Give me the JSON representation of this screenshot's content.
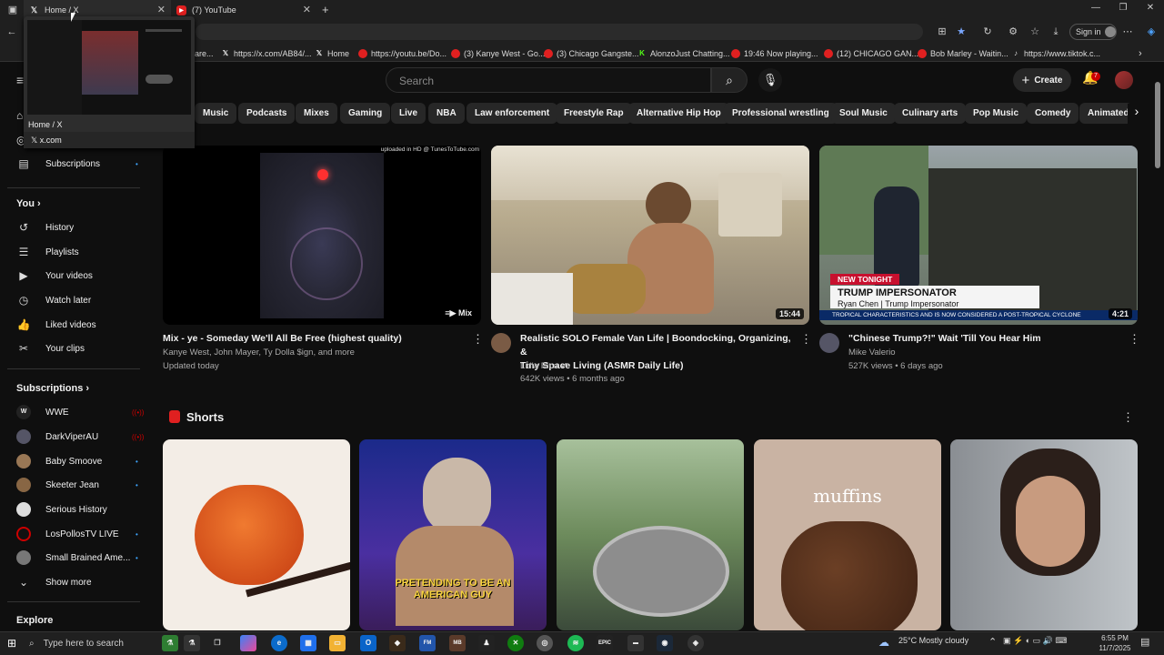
{
  "browser": {
    "tabs": [
      {
        "title": "Home / X",
        "icon": "x-logo-icon"
      },
      {
        "title": "(7) YouTube",
        "icon": "youtube-icon"
      }
    ],
    "new_tab": "+",
    "sign_in": "Sign in",
    "bookmarks": [
      "are...",
      "https://x.com/AB84/...",
      "Home",
      "https://youtu.be/Do...",
      "(3) Kanye West - Go...",
      "(3) Chicago Gangste...",
      "AlonzoJust Chatting...",
      "19:46 Now playing...",
      "(12) CHICAGO GAN...",
      "Bob Marley - Waitin...",
      "https://www.tiktok.c..."
    ],
    "hover_preview": {
      "title": "Home / X",
      "url": "x.com"
    }
  },
  "youtube": {
    "search_placeholder": "Search",
    "create_label": "Create",
    "notification_count": "7",
    "chips": [
      "Music",
      "Podcasts",
      "Mixes",
      "Gaming",
      "Live",
      "NBA",
      "Law enforcement",
      "Freestyle Rap",
      "Alternative Hip Hop",
      "Professional wrestling",
      "Soul Music",
      "Culinary arts",
      "Pop Music",
      "Comedy",
      "Animated"
    ],
    "sidebar": {
      "subscriptions_top": "Subscriptions",
      "you_header": "You",
      "you_items": [
        {
          "label": "History",
          "icon": "history-icon"
        },
        {
          "label": "Playlists",
          "icon": "playlists-icon"
        },
        {
          "label": "Your videos",
          "icon": "your-videos-icon"
        },
        {
          "label": "Watch later",
          "icon": "watch-later-icon"
        },
        {
          "label": "Liked videos",
          "icon": "liked-videos-icon"
        },
        {
          "label": "Your clips",
          "icon": "scissors-icon"
        }
      ],
      "subs_header": "Subscriptions",
      "subs": [
        {
          "label": "WWE",
          "status": "live"
        },
        {
          "label": "DarkViperAU",
          "status": "live"
        },
        {
          "label": "Baby Smoove",
          "status": "new"
        },
        {
          "label": "Skeeter Jean",
          "status": "new"
        },
        {
          "label": "Serious History",
          "status": ""
        },
        {
          "label": "LosPollosTV LIVE",
          "status": "new"
        },
        {
          "label": "Small Brained Ame...",
          "status": "new"
        }
      ],
      "show_more": "Show more",
      "explore": "Explore"
    },
    "videos": [
      {
        "title": "Mix - ye - Someday We'll All Be Free (highest quality)",
        "channel": "Kanye West, John Mayer, Ty Dolla $ign, and more",
        "meta": "Updated today",
        "badge": "Mix",
        "watermark": "uploaded in HD @ TunesToTube.com"
      },
      {
        "title_line1": "Realistic SOLO Female Van Life | Boondocking, Organizing, &",
        "title_line2": "Tiny Space Living (ASMR Daily Life)",
        "channel": "Lidia Rico",
        "meta": "642K views • 6 months ago",
        "duration": "15:44"
      },
      {
        "title": "\"Chinese Trump?!\" Wait 'Till You Hear Him",
        "channel": "Mike Valerio",
        "meta": "527K views • 6 days ago",
        "duration": "4:21",
        "overlay_tag": "NEW TONIGHT",
        "overlay_title": "TRUMP IMPERSONATOR",
        "overlay_name": "Ryan Chen | Trump Impersonator",
        "overlay_ticker": "TROPICAL CHARACTERISTICS AND IS NOW CONSIDERED A POST-TROPICAL CYCLONE"
      }
    ],
    "shorts_header": "Shorts",
    "shorts": [
      {
        "caption": ""
      },
      {
        "caption": "PRETENDING TO BE AN AMERICAN GUY"
      },
      {
        "caption": ""
      },
      {
        "caption": "muffins"
      },
      {
        "caption": ""
      }
    ]
  },
  "taskbar": {
    "search_placeholder": "Type here to search",
    "weather": "25°C  Mostly cloudy",
    "time": "6:55 PM",
    "date": "11/7/2025"
  }
}
